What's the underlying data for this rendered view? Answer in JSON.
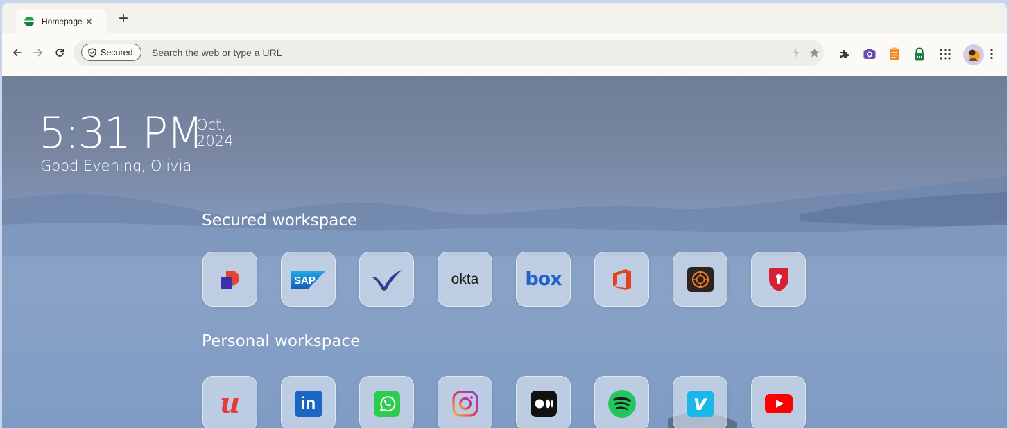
{
  "browser": {
    "tab": {
      "title": "Homepage",
      "close_glyph": "×",
      "favicon": "globe-favicon-icon"
    },
    "new_tab_glyph": "+",
    "security_chip": {
      "label": "Secured",
      "icon": "shield-check-icon"
    },
    "omnibox": {
      "placeholder": "Search the web or type a URL",
      "value": ""
    },
    "extensions": [
      "puzzle-extensions-icon",
      "camera-icon",
      "notes-icon",
      "password-lock-icon",
      "apps-grid-icon"
    ],
    "colors": {
      "chrome_bg": "#f3f1ec",
      "toolbar_bg": "#fbfaf7",
      "omnibox_bg": "#efede7"
    }
  },
  "homepage": {
    "clock": {
      "time": "5:31 PM",
      "date_line1": "Oct,",
      "date_line2": "2024"
    },
    "greeting": "Good Evening, Olivia",
    "secured_workspace": {
      "title": "Secured workspace",
      "apps": [
        {
          "name": "dayforce",
          "icon": "dayforce-icon"
        },
        {
          "name": "sap",
          "icon": "sap-icon",
          "text": "SAP"
        },
        {
          "name": "checkmark-app",
          "icon": "checkmark-logo-icon"
        },
        {
          "name": "okta",
          "icon": "okta-icon",
          "text": "okta"
        },
        {
          "name": "box",
          "icon": "box-icon",
          "text": "box"
        },
        {
          "name": "office",
          "icon": "office-icon"
        },
        {
          "name": "adobe",
          "icon": "adobe-aem-icon"
        },
        {
          "name": "password-manager",
          "icon": "shield-keyhole-icon"
        }
      ]
    },
    "personal_workspace": {
      "title": "Personal workspace",
      "apps": [
        {
          "name": "upwork",
          "icon": "upwork-icon",
          "text": "u"
        },
        {
          "name": "linkedin",
          "icon": "linkedin-icon",
          "text": "in"
        },
        {
          "name": "whatsapp",
          "icon": "whatsapp-icon"
        },
        {
          "name": "instagram",
          "icon": "instagram-icon"
        },
        {
          "name": "medium",
          "icon": "medium-icon"
        },
        {
          "name": "spotify",
          "icon": "spotify-icon"
        },
        {
          "name": "vimeo",
          "icon": "vimeo-icon",
          "text": "v"
        },
        {
          "name": "youtube",
          "icon": "youtube-icon"
        }
      ]
    }
  }
}
